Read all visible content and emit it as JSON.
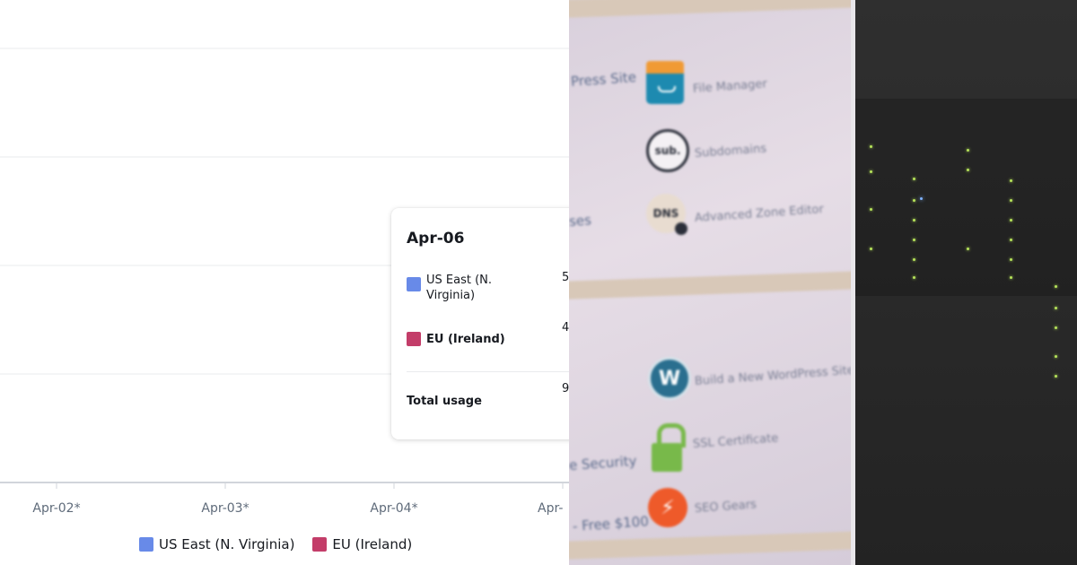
{
  "chart": {
    "x_ticks": [
      "Apr-02*",
      "Apr-03*",
      "Apr-04*",
      "Apr-"
    ],
    "legend": [
      {
        "label": "US East (N. Virginia)",
        "color": "#688ae8"
      },
      {
        "label": "EU (Ireland)",
        "color": "#c33d69"
      }
    ]
  },
  "tooltip": {
    "title": "Apr-06",
    "rows": [
      {
        "label": "US East (N. Virginia)",
        "color": "#688ae8",
        "value": "5"
      },
      {
        "label": "EU (Ireland)",
        "color": "#c33d69",
        "value": "4"
      }
    ],
    "total_label": "Total usage",
    "total_value": "9"
  },
  "photo": {
    "labels": [
      "Press Site",
      "File Manager",
      "Subdomains",
      "ses",
      "Advanced Zone Editor",
      "Build a New WordPress Site",
      "SSL Certificate",
      "e Security",
      "SEO Gears",
      "- Free $100"
    ],
    "icons": [
      "file-manager-icon",
      "subdomains-icon",
      "dns-icon",
      "wordpress-icon",
      "ssl-lock-icon",
      "seo-gears-icon"
    ],
    "icon_text": {
      "sub": "sub.",
      "dns": "DNS",
      "wp": "W",
      "seo": "⚡"
    }
  }
}
